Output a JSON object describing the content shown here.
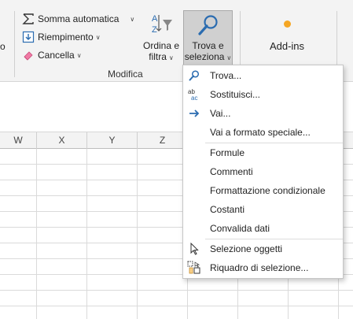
{
  "ribbon": {
    "left_fragment": "o",
    "somma_label": "Somma automatica",
    "riempimento_label": "Riempimento",
    "cancella_label": "Cancella",
    "ordina_line1": "Ordina e",
    "ordina_line2": "filtra",
    "trova_line1": "Trova e",
    "trova_line2": "seleziona",
    "group_label": "Modifica",
    "addins_label": "Add-ins"
  },
  "columns": [
    "W",
    "X",
    "Y",
    "Z"
  ],
  "menu": {
    "items": [
      {
        "label": "Trova...",
        "icon": "magnifier-icon"
      },
      {
        "label": "Sostituisci...",
        "icon": "replace-abc-icon"
      },
      {
        "label": "Vai...",
        "icon": "arrow-right-icon"
      },
      {
        "label": "Vai a formato speciale...",
        "icon": ""
      },
      {
        "label": "Formule",
        "icon": ""
      },
      {
        "label": "Commenti",
        "icon": ""
      },
      {
        "label": "Formattazione condizionale",
        "icon": ""
      },
      {
        "label": "Costanti",
        "icon": ""
      },
      {
        "label": "Convalida dati",
        "icon": ""
      },
      {
        "label": "Selezione oggetti",
        "icon": "cursor-arrow-icon"
      },
      {
        "label": "Riquadro di selezione...",
        "icon": "selection-pane-icon"
      }
    ]
  },
  "colors": {
    "accent_green": "#217346",
    "addins_orange": "#f5a623",
    "icon_blue": "#2b6cb0"
  }
}
